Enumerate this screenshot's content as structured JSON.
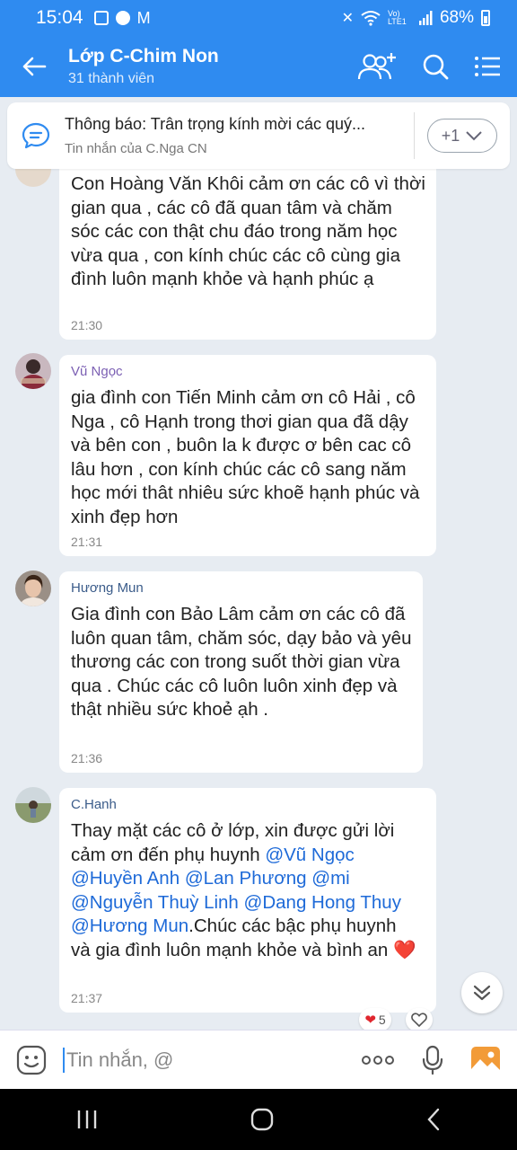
{
  "status": {
    "time": "15:04",
    "battery": "68%",
    "network": "Vo) LTE1"
  },
  "header": {
    "title": "Lớp C-Chim Non",
    "subtitle": "31 thành viên"
  },
  "pinned": {
    "title": "Thông báo: Trân trọng kính mời các quý...",
    "sender": "Tin nhắn của C.Nga CN",
    "more": "+1"
  },
  "messages": [
    {
      "text": "Con Hoàng Văn Khôi cảm ơn các cô vì thời gian qua , các cô đã quan tâm và chăm sóc các con thật chu đáo trong năm học vừa qua , con kính chúc các cô cùng gia đình luôn mạnh khỏe và hạnh phúc ạ",
      "time": "21:30"
    },
    {
      "name": "Vũ Ngọc",
      "name_color": "#7b5fb3",
      "text": "gia đình con Tiến Minh cảm ơn cô Hải , cô Nga , cô Hạnh trong thơi gian qua đã dậy và bên con , buôn la k được ơ bên cac cô lâu hơn , con kính chúc các cô sang năm học mới thât nhiêu sức khoẽ hạnh phúc và xinh đẹp hơn",
      "time": "21:31"
    },
    {
      "name": "Hương Mun",
      "name_color": "#3b5c8a",
      "text": "Gia đình con Bảo Lâm cảm ơn các cô đã luôn quan tâm, chăm sóc, dạy bảo và yêu thương các con trong suốt thời gian vừa qua . Chúc các cô luôn luôn xinh đẹp và thật nhiều sức khoẻ ạh .",
      "time": "21:36"
    },
    {
      "name": "C.Hanh",
      "name_color": "#3b5c8a",
      "intro": "Thay mặt các cô ở lớp, xin được gửi lời cảm ơn đến phụ huynh",
      "mentions": [
        "@Vũ Ngọc",
        "@Huyền Anh",
        "@Lan Phương",
        "@mi",
        "@Nguyễn Thuỳ Linh",
        "@Dang Hong Thuy",
        "@Hương Mun"
      ],
      "outro": ".Chúc các bậc phụ huynh và gia đình luôn mạnh khỏe và bình an",
      "emoji": "❤️",
      "time": "21:37",
      "reaction_count": "5"
    }
  ],
  "input": {
    "placeholder": "Tin nhắn, @"
  },
  "colors": {
    "accent": "#2f8bf0",
    "mention": "#1e6ad8",
    "background": "#e7ecf2"
  }
}
